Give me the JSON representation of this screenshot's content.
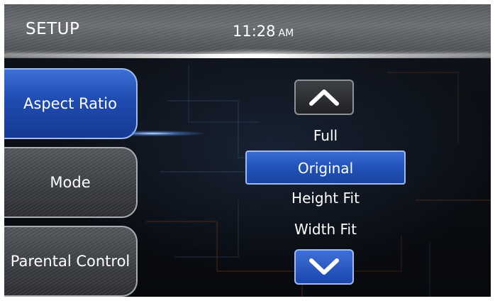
{
  "header": {
    "title": "SETUP",
    "time": "11:28",
    "ampm": "AM"
  },
  "sidebar": {
    "items": [
      {
        "label": "Aspect Ratio",
        "active": true
      },
      {
        "label": "Mode",
        "active": false
      },
      {
        "label": "Parental Control",
        "active": false
      }
    ]
  },
  "options": {
    "up_icon": "chevron-up-icon",
    "down_icon": "chevron-down-icon",
    "items": [
      {
        "label": "Full",
        "selected": false
      },
      {
        "label": "Original",
        "selected": true
      },
      {
        "label": "Height Fit",
        "selected": false
      },
      {
        "label": "Width Fit",
        "selected": false
      }
    ]
  },
  "colors": {
    "accent_blue": "#2152b8",
    "header_gray": "#5a5d62",
    "background": "#0a0d12"
  }
}
